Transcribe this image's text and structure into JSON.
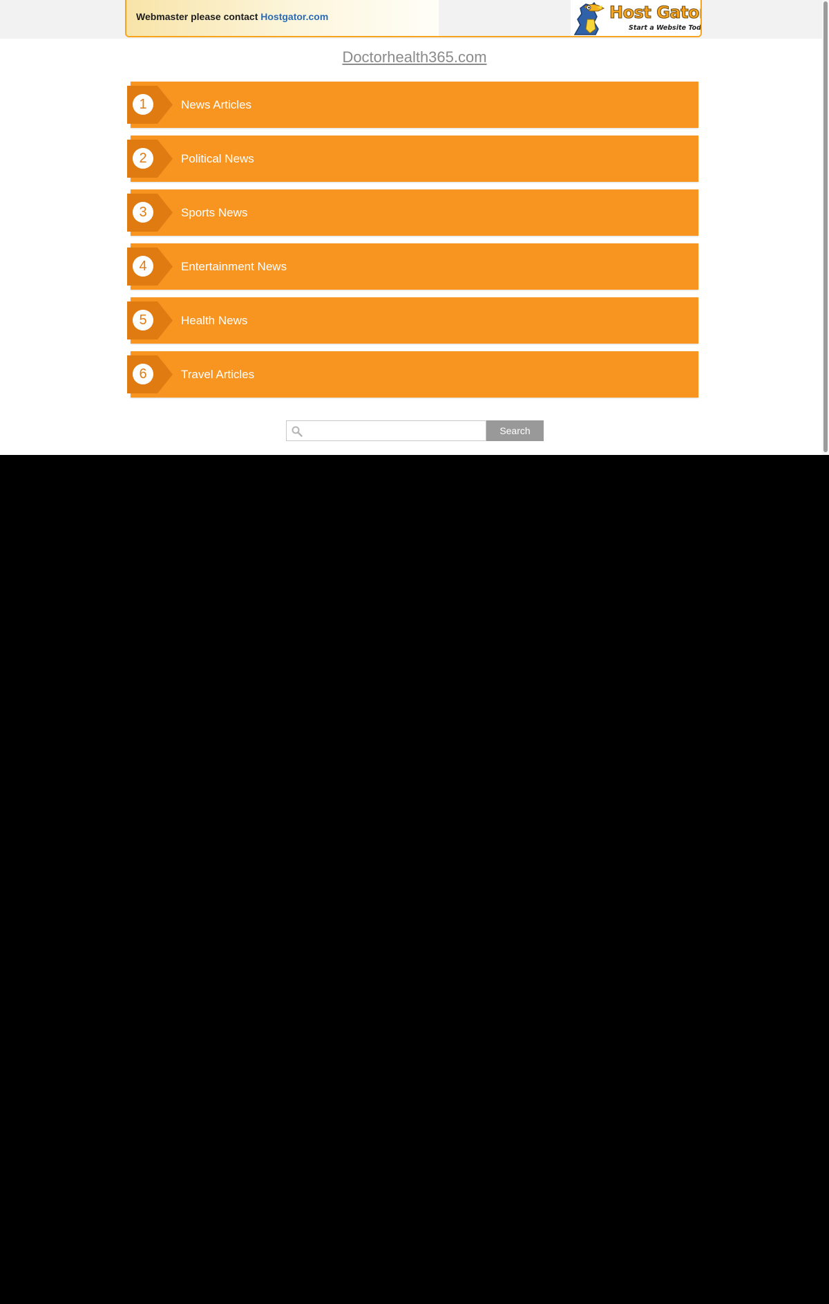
{
  "banner": {
    "message": "Webmaster please contact ",
    "link_text": "Hostgator.com",
    "logo_name": "Host Gator",
    "logo_tagline": "Start a Website Today!",
    "logo_icon": "gator-mascot-icon"
  },
  "site": {
    "title": "Doctorhealth365.com"
  },
  "menu": {
    "items": [
      {
        "number": "1",
        "label": "News Articles"
      },
      {
        "number": "2",
        "label": "Political News"
      },
      {
        "number": "3",
        "label": "Sports News"
      },
      {
        "number": "4",
        "label": "Entertainment News"
      },
      {
        "number": "5",
        "label": "Health News"
      },
      {
        "number": "6",
        "label": "Travel Articles"
      }
    ]
  },
  "search": {
    "value": "",
    "placeholder": "",
    "button_label": "Search",
    "icon": "search-icon"
  },
  "colors": {
    "menu_bar": "#f89521",
    "menu_badge": "#e07b12",
    "banner_border": "#f6a31e",
    "link": "#2a6bb4",
    "search_button": "#999999"
  }
}
